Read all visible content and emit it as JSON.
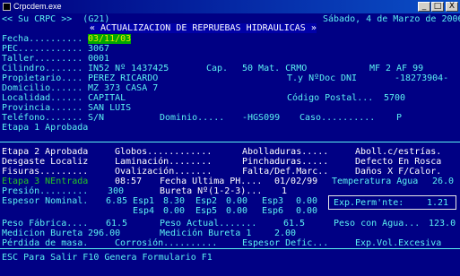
{
  "window": {
    "title": "Crpcdem.exe",
    "btn_min": "_",
    "btn_max": "□",
    "btn_close": "X"
  },
  "header": {
    "left": "<< Su CRPC >>  (G21)",
    "right": "Sábado, 4 de Marzo de 2006",
    "title": "« ACTUALIZACION DE REPRUEBAS HIDRAULICAS »"
  },
  "form": {
    "fecha_label": "Fecha..........",
    "fecha_value": "03/11/03",
    "pec_label": "PEC............",
    "pec_value": "3067",
    "taller_label": "Taller.........",
    "taller_value": "0001",
    "cilindro_label": "Cilindro.......",
    "cilindro_value": "IN52 Nº 1437425",
    "cap_label": "Cap.",
    "cap_value": "50 Mat. CRMO",
    "mf_label": "MF",
    "mf_value": "2 AF 99",
    "propietario_label": "Propietario....",
    "propietario_value": "PEREZ RICARDO",
    "tdoc_label": "T.y NºDoc",
    "tdoc_type": "DNI",
    "tdoc_number": "-18273904-",
    "domicilio_label": "Domicilio......",
    "domicilio_value": "MZ 373 CASA 7",
    "localidad_label": "Localidad......",
    "localidad_value": "CAPITAL",
    "codpostal_label": "Código Postal...",
    "codpostal_value": "5700",
    "provincia_label": "Provincia......",
    "provincia_value": "SAN LUIS",
    "telefono_label": "Teléfono.......",
    "telefono_value": "S/N",
    "dominio_label": "Dominio.....",
    "dominio_value": "-HGS099",
    "caso_label": "Caso..........",
    "caso_value": "P",
    "etapa1": "Etapa 1 Aprobada"
  },
  "etapa2": {
    "title": "Etapa 2 Aprobada",
    "globos": "Globos............",
    "abolladuras": "Abolladuras.....",
    "aboll_estrias": "Aboll.c/estrías.",
    "desgaste": "Desgaste Localiz",
    "laminacion": "Laminación........",
    "pinchaduras": "Pinchaduras.....",
    "defecto_rosca": "Defecto En Rosca",
    "fisuras": "Fisuras.........",
    "ovalizacion": "Ovalización.......",
    "falta_def": "Falta/Def.Marc..",
    "danos_fcalor": "Daños X F/Calor."
  },
  "etapa3": {
    "title": "Etapa 3 NEntrada",
    "entrada": "08:57",
    "fecha_ultima_label": "Fecha Ultima PH....",
    "fecha_ultima_value": "01/02/99",
    "temp_label": "Temperatura Agua",
    "temp_value": "26.0",
    "presion_label": "Presión.........",
    "presion_value": "300",
    "bureta_label": "Bureta Nº(1-2-3)...",
    "bureta_value": "1",
    "espesor_label": "Espesor Nominal.",
    "espesor_value": "6.85",
    "esp1_label": "Esp1",
    "esp1_value": "8.30",
    "esp2_label": "Esp2",
    "esp2_value": "0.00",
    "esp3_label": "Esp3",
    "esp3_value": "0.00",
    "esp4_label": "Esp4",
    "esp4_value": "0.00",
    "esp5_label": "Esp5",
    "esp5_value": "0.00",
    "esp6_label": "Esp6",
    "esp6_value": "0.00",
    "exp_perm_label": "Exp.Perm'nte:",
    "exp_perm_value": "1.21",
    "peso_fabrica_label": "Peso Fábrica....",
    "peso_fabrica_value": "61.5",
    "peso_actual_label": "Peso Actual.......",
    "peso_actual_value": "61.5",
    "peso_agua_label": "Peso con Agua...",
    "peso_agua_value": "123.0",
    "med_bureta_label": "Medicion Bureta",
    "med_bureta_value": "296.00",
    "med_bureta1_label": "Medición Bureta 1",
    "med_bureta1_value": "2.00",
    "perdida_masa": "Pérdida de masa.",
    "corrosion": "Corrosión..........",
    "espesor_defic": "Espesor Defic...",
    "exp_vol": "Exp.Vol.Excesiva"
  },
  "status": {
    "text": "ESC Para Salir F10 Genera Formulario F1"
  }
}
